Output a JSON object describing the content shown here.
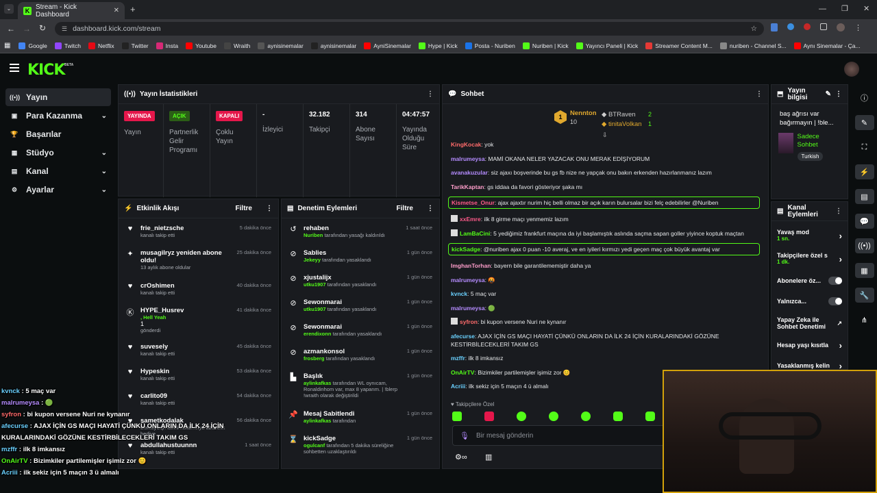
{
  "browser": {
    "tab_title": "Stream - Kick Dashboard",
    "url": "dashboard.kick.com/stream",
    "bookmarks": [
      {
        "label": "Google",
        "color": "#4285f4"
      },
      {
        "label": "Twitch",
        "color": "#9146ff"
      },
      {
        "label": "Netflix",
        "color": "#e50914"
      },
      {
        "label": "Twitter",
        "color": "#222"
      },
      {
        "label": "Insta",
        "color": "#d62976"
      },
      {
        "label": "Youtube",
        "color": "#ff0000"
      },
      {
        "label": "Wraith",
        "color": "#444"
      },
      {
        "label": "aynisinemalar",
        "color": "#555"
      },
      {
        "label": "aynisinemalar",
        "color": "#222"
      },
      {
        "label": "AyniSinemalar",
        "color": "#ff0000"
      },
      {
        "label": "Hype | Kick",
        "color": "#53fc18"
      },
      {
        "label": "Posta - Nuriben",
        "color": "#1a73e8"
      },
      {
        "label": "Nuriben | Kick",
        "color": "#53fc18"
      },
      {
        "label": "Yayıncı Paneli | Kick",
        "color": "#53fc18"
      },
      {
        "label": "Streamer Content M...",
        "color": "#e53935"
      },
      {
        "label": "nuriben - Channel S...",
        "color": "#888"
      },
      {
        "label": "Aynı Sinemalar - Ça...",
        "color": "#ff0000"
      }
    ]
  },
  "brand": {
    "logo": "KICK",
    "beta": "BETA"
  },
  "sidebar": {
    "items": [
      {
        "label": "Yayın",
        "icon": "broadcast-icon"
      },
      {
        "label": "Para Kazanma",
        "icon": "money-icon"
      },
      {
        "label": "Başarılar",
        "icon": "trophy-icon"
      },
      {
        "label": "Stüdyo",
        "icon": "studio-icon"
      },
      {
        "label": "Kanal",
        "icon": "channel-icon"
      },
      {
        "label": "Ayarlar",
        "icon": "gear-icon"
      }
    ]
  },
  "stats": {
    "title": "Yayın İstatistikleri",
    "yayin": {
      "badge": "YAYINDA",
      "label": "Yayın"
    },
    "partner": {
      "badge": "AÇIK",
      "label": "Partnerlik Gelir Programı"
    },
    "multi": {
      "badge": "KAPALI",
      "label": "Çoklu Yayın"
    },
    "viewers": {
      "value": "-",
      "label": "İzleyici"
    },
    "followers": {
      "value": "32.182",
      "label": "Takipçi"
    },
    "subs": {
      "value": "314",
      "label": "Abone Sayısı"
    },
    "uptime": {
      "value": "04:47:57",
      "label": "Yayında Olduğu Süre"
    }
  },
  "activity": {
    "title": "Etkinlik Akışı",
    "filter": "Filtre",
    "items": [
      {
        "name": "frie_nietzsche",
        "sub": "kanalı takip etti",
        "time": "5 dakika önce"
      },
      {
        "name": "musagilryz yeniden abone oldu!",
        "sub": "13 aylık abone oldular",
        "time": "25 dakika önce"
      },
      {
        "name": "crOshimen",
        "sub": "kanalı takip etti",
        "time": "40 dakika önce"
      },
      {
        "name": "HYPE_Husrev",
        "extra": ", Hell Yeah",
        "gift": "1",
        "sub": "gönderdi",
        "time": "41 dakika önce"
      },
      {
        "name": "suvesely",
        "sub": "kanalı takip etti",
        "time": "45 dakika önce"
      },
      {
        "name": "Hypeskin",
        "sub": "kanalı takip etti",
        "time": "53 dakika önce"
      },
      {
        "name": "carlito09",
        "sub": "kanalı takip etti",
        "time": "54 dakika önce"
      },
      {
        "name": "sametkodalak",
        "sub": "BerkayCqn isimli kullanıcıya abonelik hediye",
        "time": "56 dakika önce"
      },
      {
        "name": "abdullahustuunnn",
        "sub": "kanalı takip etti",
        "time": "1 saat önce"
      }
    ]
  },
  "moderation": {
    "title": "Denetim Eylemleri",
    "filter": "Filtre",
    "items": [
      {
        "name": "rehaben",
        "actor": "Nuriben",
        "sub": "tarafından yasağı kaldırıldı",
        "time": "1 saat önce"
      },
      {
        "name": "Sablies",
        "actor": "Jekeyy",
        "sub": "tarafından yasaklandı",
        "time": "1 gün önce"
      },
      {
        "name": "xjustalijx",
        "actor": "utku1907",
        "sub": "tarafından yasaklandı",
        "time": "1 gün önce"
      },
      {
        "name": "Sewonmarai",
        "actor": "utku1907",
        "sub": "tarafından yasaklandı",
        "time": "1 gün önce"
      },
      {
        "name": "Sewonmarai",
        "actor": "erendixonn",
        "sub": "tarafından yasaklandı",
        "time": "1 gün önce"
      },
      {
        "name": "azmankonsol",
        "actor": "frosberg",
        "sub": "tarafından yasaklandı",
        "time": "1 gün önce"
      },
      {
        "name": "Başlık",
        "actor": "aylinkafkas",
        "sub": "tarafından WL oynıcam, Ronaldinhom var, max 8 yaparım. | !blerp !wraith olarak değiştirildi",
        "time": "1 gün önce"
      },
      {
        "name": "Mesaj Sabitlendi",
        "actor": "aylinkafkas",
        "sub": "tarafından",
        "time": "1 gün önce"
      },
      {
        "name": "kickSadge",
        "actor": "ogulcanf",
        "sub": "tarafından 5 dakika süreliğine sohbetten uzaklaştırıldı",
        "time": "1 gün önce"
      }
    ]
  },
  "chat": {
    "title": "Sohbet",
    "top": [
      {
        "rank": "1",
        "name": "Nennton",
        "count": "10"
      },
      {
        "rank": "",
        "name": "BTRaven",
        "count": "2"
      },
      {
        "rank": "",
        "name": "tinitaVolkan",
        "count": "1"
      }
    ],
    "messages": [
      {
        "user": "KingKocak",
        "color": "#ff6b6b",
        "text": "yok"
      },
      {
        "user": "malrumeysa",
        "color": "#b58cff",
        "text": "MAMİ OKANA NELER YAZACAK ONU MERAK EDİŞİYORUM"
      },
      {
        "user": "avanakuzular",
        "color": "#b58cff",
        "text": "siz ajaxı boşverinde bu gs fb nize ne yapçak onu bakın erkenden hazırlanmanız lazım"
      },
      {
        "user": "TarikKaptan",
        "color": "#ff9ecb",
        "text": "gs iddaa da favori gösteriyor şaka mı"
      },
      {
        "user": "Kismetse_Onur",
        "color": "#ff5a8a",
        "text": "ajax ajaxtır nurim hiç belli olmaz bir açık karın bulursalar bizi felç edebilirler @Nuriben",
        "hl": true
      },
      {
        "user": "xxEmre",
        "color": "#ff5a8a",
        "text": "ilk 8 girme maçı yenmemiz lazım",
        "badge": true
      },
      {
        "user": "LamBaCini",
        "color": "#53fc18",
        "text": "5 yediğimiz frankfurt maçına da iyi başlamıştık aslında saçma sapan goller yiyince koptuk maçtan",
        "badge": true
      },
      {
        "user": "kickSadge",
        "color": "#53fc18",
        "text": "@nuriben ajax 0 puan -10 averaj, ve en iyileri kırmızı yedi geçen maç çok büyük avantaj var",
        "hl": true
      },
      {
        "user": "ImghanTorhan",
        "color": "#ff9ecb",
        "text": "bayern bile garantilememiştir daha ya"
      },
      {
        "user": "malrumeysa",
        "color": "#b58cff",
        "text": "🤬"
      },
      {
        "user": "kvnck",
        "color": "#6ad1ff",
        "text": "5 maç var"
      },
      {
        "user": "malrumeysa",
        "color": "#b58cff",
        "text": "🟢"
      },
      {
        "user": "syfron",
        "color": "#ff6b6b",
        "text": "bi kupon versene Nuri ne kynanır",
        "badge": true
      },
      {
        "user": "afecurse",
        "color": "#6ad1ff",
        "text": "AJAX İÇİN GS MAÇI HAYATİ ÇÜNKÜ ONLARIN DA İLK 24 İÇİN KURALARINDAKİ GÖZÜNE KESTİRBİLECEKLERİ TAKIM GS"
      },
      {
        "user": "mzffr",
        "color": "#6ad1ff",
        "text": "ilk 8 imkansız"
      },
      {
        "user": "OnAirTV",
        "color": "#53fc18",
        "text": "Bizimkiler partilemişler işimiz zor 😊"
      },
      {
        "user": "Acriii",
        "color": "#6ad1ff",
        "text": "ilk sekiz için 5 maçın 4 ü almalı"
      }
    ],
    "followers_only": "Takipçilere Özel",
    "input_placeholder": "Bir mesaj gönderin"
  },
  "stream_info": {
    "title": "Yayın bilgisi",
    "desc": "baş ağrısı var bağırmayın | !ble...",
    "category": "Sadece Sohbet",
    "lang": "Turkish"
  },
  "channel_actions": {
    "title": "Kanal Eylemleri",
    "items": [
      {
        "label": "Yavaş mod",
        "sub": "1 sn."
      },
      {
        "label": "Takipçilere özel s",
        "sub": "1 dk."
      },
      {
        "label": "Abonelere öz..."
      },
      {
        "label": "Yalnızca..."
      },
      {
        "label": "Yapay Zeka ile Sohbet Denetimi"
      },
      {
        "label": "Hesap yaşı kısıtla"
      },
      {
        "label": "Yasaklanmış kelin"
      }
    ]
  },
  "overlay_chat": [
    {
      "user": "kvnck",
      "color": "#6ad1ff",
      "text": "5 maç var"
    },
    {
      "user": "malrumeysa",
      "color": "#b58cff",
      "text": "🟢"
    },
    {
      "user": "syfron",
      "color": "#ff6b6b",
      "text": "bi kupon versene Nuri ne kynanır"
    },
    {
      "user": "afecurse",
      "color": "#6ad1ff",
      "text": "AJAX İÇİN GS MAÇI HAYATİ ÇÜNKÜ ONLARIN DA İLK 24 İÇİN KURALARINDAKİ GÖZÜNE KESTİRBİLECEKLERİ TAKIM GS"
    },
    {
      "user": "mzffr",
      "color": "#6ad1ff",
      "text": "ilk 8 imkansız"
    },
    {
      "user": "OnAirTV",
      "color": "#53fc18",
      "text": "Bizimkiler partilemişler işimiz zor 😊"
    },
    {
      "user": "Acriii",
      "color": "#6ad1ff",
      "text": "ilk sekiz için 5 maçın 3 ü almalı"
    }
  ]
}
